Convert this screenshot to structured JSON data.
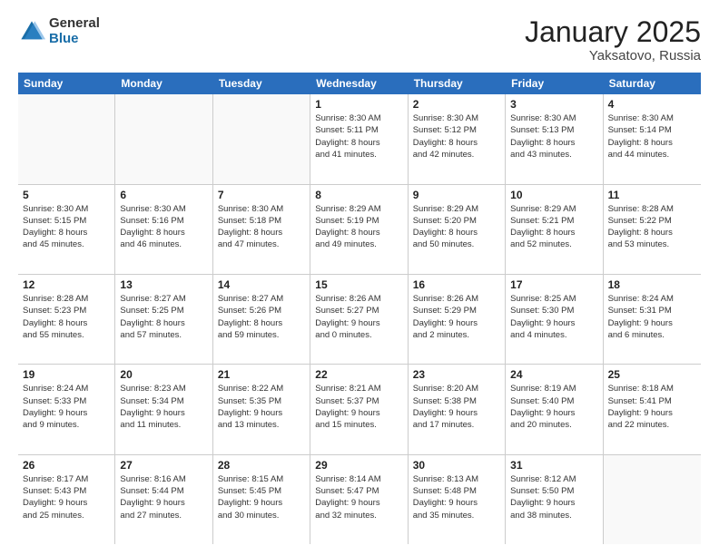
{
  "logo": {
    "general": "General",
    "blue": "Blue"
  },
  "title": "January 2025",
  "location": "Yaksatovo, Russia",
  "days": [
    "Sunday",
    "Monday",
    "Tuesday",
    "Wednesday",
    "Thursday",
    "Friday",
    "Saturday"
  ],
  "weeks": [
    [
      {
        "day": "",
        "info": ""
      },
      {
        "day": "",
        "info": ""
      },
      {
        "day": "",
        "info": ""
      },
      {
        "day": "1",
        "info": "Sunrise: 8:30 AM\nSunset: 5:11 PM\nDaylight: 8 hours\nand 41 minutes."
      },
      {
        "day": "2",
        "info": "Sunrise: 8:30 AM\nSunset: 5:12 PM\nDaylight: 8 hours\nand 42 minutes."
      },
      {
        "day": "3",
        "info": "Sunrise: 8:30 AM\nSunset: 5:13 PM\nDaylight: 8 hours\nand 43 minutes."
      },
      {
        "day": "4",
        "info": "Sunrise: 8:30 AM\nSunset: 5:14 PM\nDaylight: 8 hours\nand 44 minutes."
      }
    ],
    [
      {
        "day": "5",
        "info": "Sunrise: 8:30 AM\nSunset: 5:15 PM\nDaylight: 8 hours\nand 45 minutes."
      },
      {
        "day": "6",
        "info": "Sunrise: 8:30 AM\nSunset: 5:16 PM\nDaylight: 8 hours\nand 46 minutes."
      },
      {
        "day": "7",
        "info": "Sunrise: 8:30 AM\nSunset: 5:18 PM\nDaylight: 8 hours\nand 47 minutes."
      },
      {
        "day": "8",
        "info": "Sunrise: 8:29 AM\nSunset: 5:19 PM\nDaylight: 8 hours\nand 49 minutes."
      },
      {
        "day": "9",
        "info": "Sunrise: 8:29 AM\nSunset: 5:20 PM\nDaylight: 8 hours\nand 50 minutes."
      },
      {
        "day": "10",
        "info": "Sunrise: 8:29 AM\nSunset: 5:21 PM\nDaylight: 8 hours\nand 52 minutes."
      },
      {
        "day": "11",
        "info": "Sunrise: 8:28 AM\nSunset: 5:22 PM\nDaylight: 8 hours\nand 53 minutes."
      }
    ],
    [
      {
        "day": "12",
        "info": "Sunrise: 8:28 AM\nSunset: 5:23 PM\nDaylight: 8 hours\nand 55 minutes."
      },
      {
        "day": "13",
        "info": "Sunrise: 8:27 AM\nSunset: 5:25 PM\nDaylight: 8 hours\nand 57 minutes."
      },
      {
        "day": "14",
        "info": "Sunrise: 8:27 AM\nSunset: 5:26 PM\nDaylight: 8 hours\nand 59 minutes."
      },
      {
        "day": "15",
        "info": "Sunrise: 8:26 AM\nSunset: 5:27 PM\nDaylight: 9 hours\nand 0 minutes."
      },
      {
        "day": "16",
        "info": "Sunrise: 8:26 AM\nSunset: 5:29 PM\nDaylight: 9 hours\nand 2 minutes."
      },
      {
        "day": "17",
        "info": "Sunrise: 8:25 AM\nSunset: 5:30 PM\nDaylight: 9 hours\nand 4 minutes."
      },
      {
        "day": "18",
        "info": "Sunrise: 8:24 AM\nSunset: 5:31 PM\nDaylight: 9 hours\nand 6 minutes."
      }
    ],
    [
      {
        "day": "19",
        "info": "Sunrise: 8:24 AM\nSunset: 5:33 PM\nDaylight: 9 hours\nand 9 minutes."
      },
      {
        "day": "20",
        "info": "Sunrise: 8:23 AM\nSunset: 5:34 PM\nDaylight: 9 hours\nand 11 minutes."
      },
      {
        "day": "21",
        "info": "Sunrise: 8:22 AM\nSunset: 5:35 PM\nDaylight: 9 hours\nand 13 minutes."
      },
      {
        "day": "22",
        "info": "Sunrise: 8:21 AM\nSunset: 5:37 PM\nDaylight: 9 hours\nand 15 minutes."
      },
      {
        "day": "23",
        "info": "Sunrise: 8:20 AM\nSunset: 5:38 PM\nDaylight: 9 hours\nand 17 minutes."
      },
      {
        "day": "24",
        "info": "Sunrise: 8:19 AM\nSunset: 5:40 PM\nDaylight: 9 hours\nand 20 minutes."
      },
      {
        "day": "25",
        "info": "Sunrise: 8:18 AM\nSunset: 5:41 PM\nDaylight: 9 hours\nand 22 minutes."
      }
    ],
    [
      {
        "day": "26",
        "info": "Sunrise: 8:17 AM\nSunset: 5:43 PM\nDaylight: 9 hours\nand 25 minutes."
      },
      {
        "day": "27",
        "info": "Sunrise: 8:16 AM\nSunset: 5:44 PM\nDaylight: 9 hours\nand 27 minutes."
      },
      {
        "day": "28",
        "info": "Sunrise: 8:15 AM\nSunset: 5:45 PM\nDaylight: 9 hours\nand 30 minutes."
      },
      {
        "day": "29",
        "info": "Sunrise: 8:14 AM\nSunset: 5:47 PM\nDaylight: 9 hours\nand 32 minutes."
      },
      {
        "day": "30",
        "info": "Sunrise: 8:13 AM\nSunset: 5:48 PM\nDaylight: 9 hours\nand 35 minutes."
      },
      {
        "day": "31",
        "info": "Sunrise: 8:12 AM\nSunset: 5:50 PM\nDaylight: 9 hours\nand 38 minutes."
      },
      {
        "day": "",
        "info": ""
      }
    ]
  ]
}
